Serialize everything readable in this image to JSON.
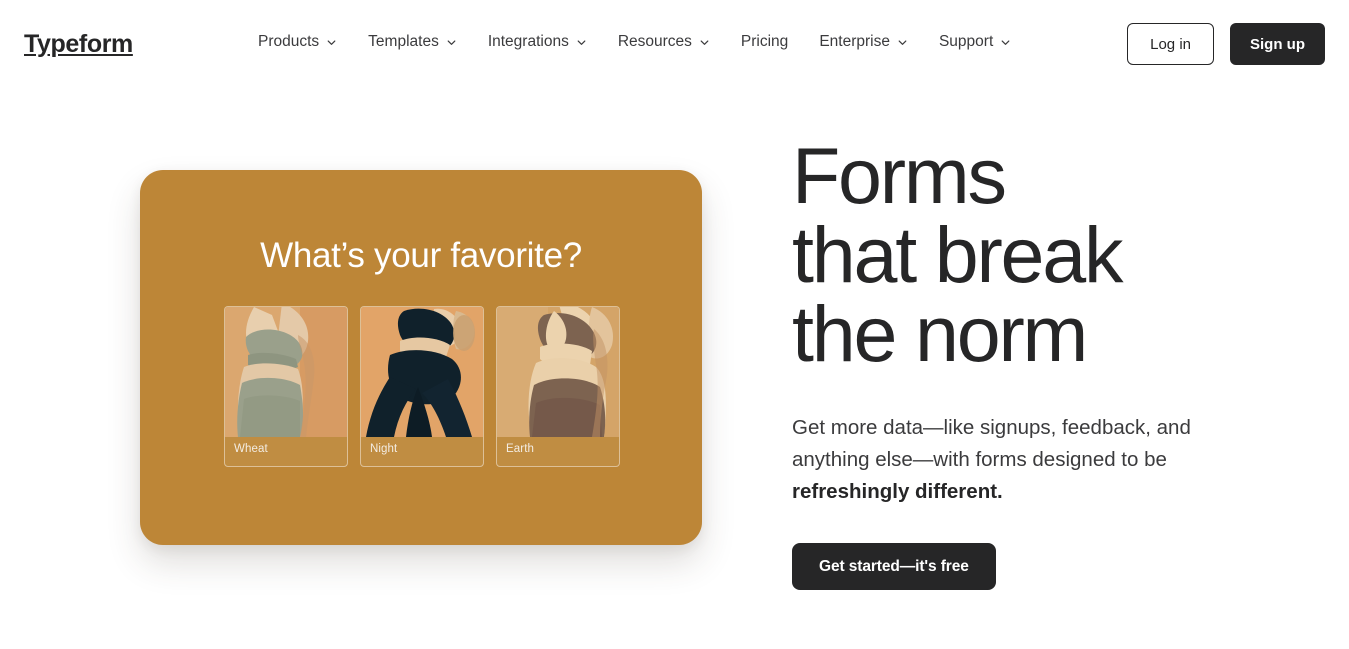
{
  "header": {
    "brand": "Typeform",
    "nav": [
      {
        "label": "Products",
        "has_caret": true,
        "icon": "chevron-down-icon"
      },
      {
        "label": "Templates",
        "has_caret": true,
        "icon": "chevron-down-icon"
      },
      {
        "label": "Integrations",
        "has_caret": true,
        "icon": "chevron-down-icon"
      },
      {
        "label": "Resources",
        "has_caret": true,
        "icon": "chevron-down-icon"
      },
      {
        "label": "Pricing",
        "has_caret": false,
        "icon": ""
      },
      {
        "label": "Enterprise",
        "has_caret": true,
        "icon": "chevron-down-icon"
      },
      {
        "label": "Support",
        "has_caret": true,
        "icon": "chevron-down-icon"
      }
    ],
    "login_label": "Log in",
    "signup_label": "Sign up"
  },
  "hero": {
    "title_line1": "Forms",
    "title_line2": "that break",
    "title_line3": "the norm",
    "subtitle_normal": "Get more data—like signups, feedback, and anything else—with forms designed to be ",
    "subtitle_bold": "refreshingly different.",
    "cta_label": "Get started—it's free"
  },
  "preview": {
    "question": "What’s your favorite?",
    "choices": [
      {
        "label": "Wheat",
        "garment_color": "#9aa08b",
        "skin_color": "#e4c9a8",
        "backdrop_color": "#d79b63"
      },
      {
        "label": "Night",
        "garment_color": "#10212b",
        "skin_color": "#e9cda9",
        "backdrop_color": "#e09e5f"
      },
      {
        "label": "Earth",
        "garment_color": "#7d6350",
        "skin_color": "#ecd3ae",
        "backdrop_color": "#d4a468"
      }
    ]
  },
  "colors": {
    "card_background": "#bd8637",
    "ink": "#262627",
    "page_background": "#ffffff"
  }
}
